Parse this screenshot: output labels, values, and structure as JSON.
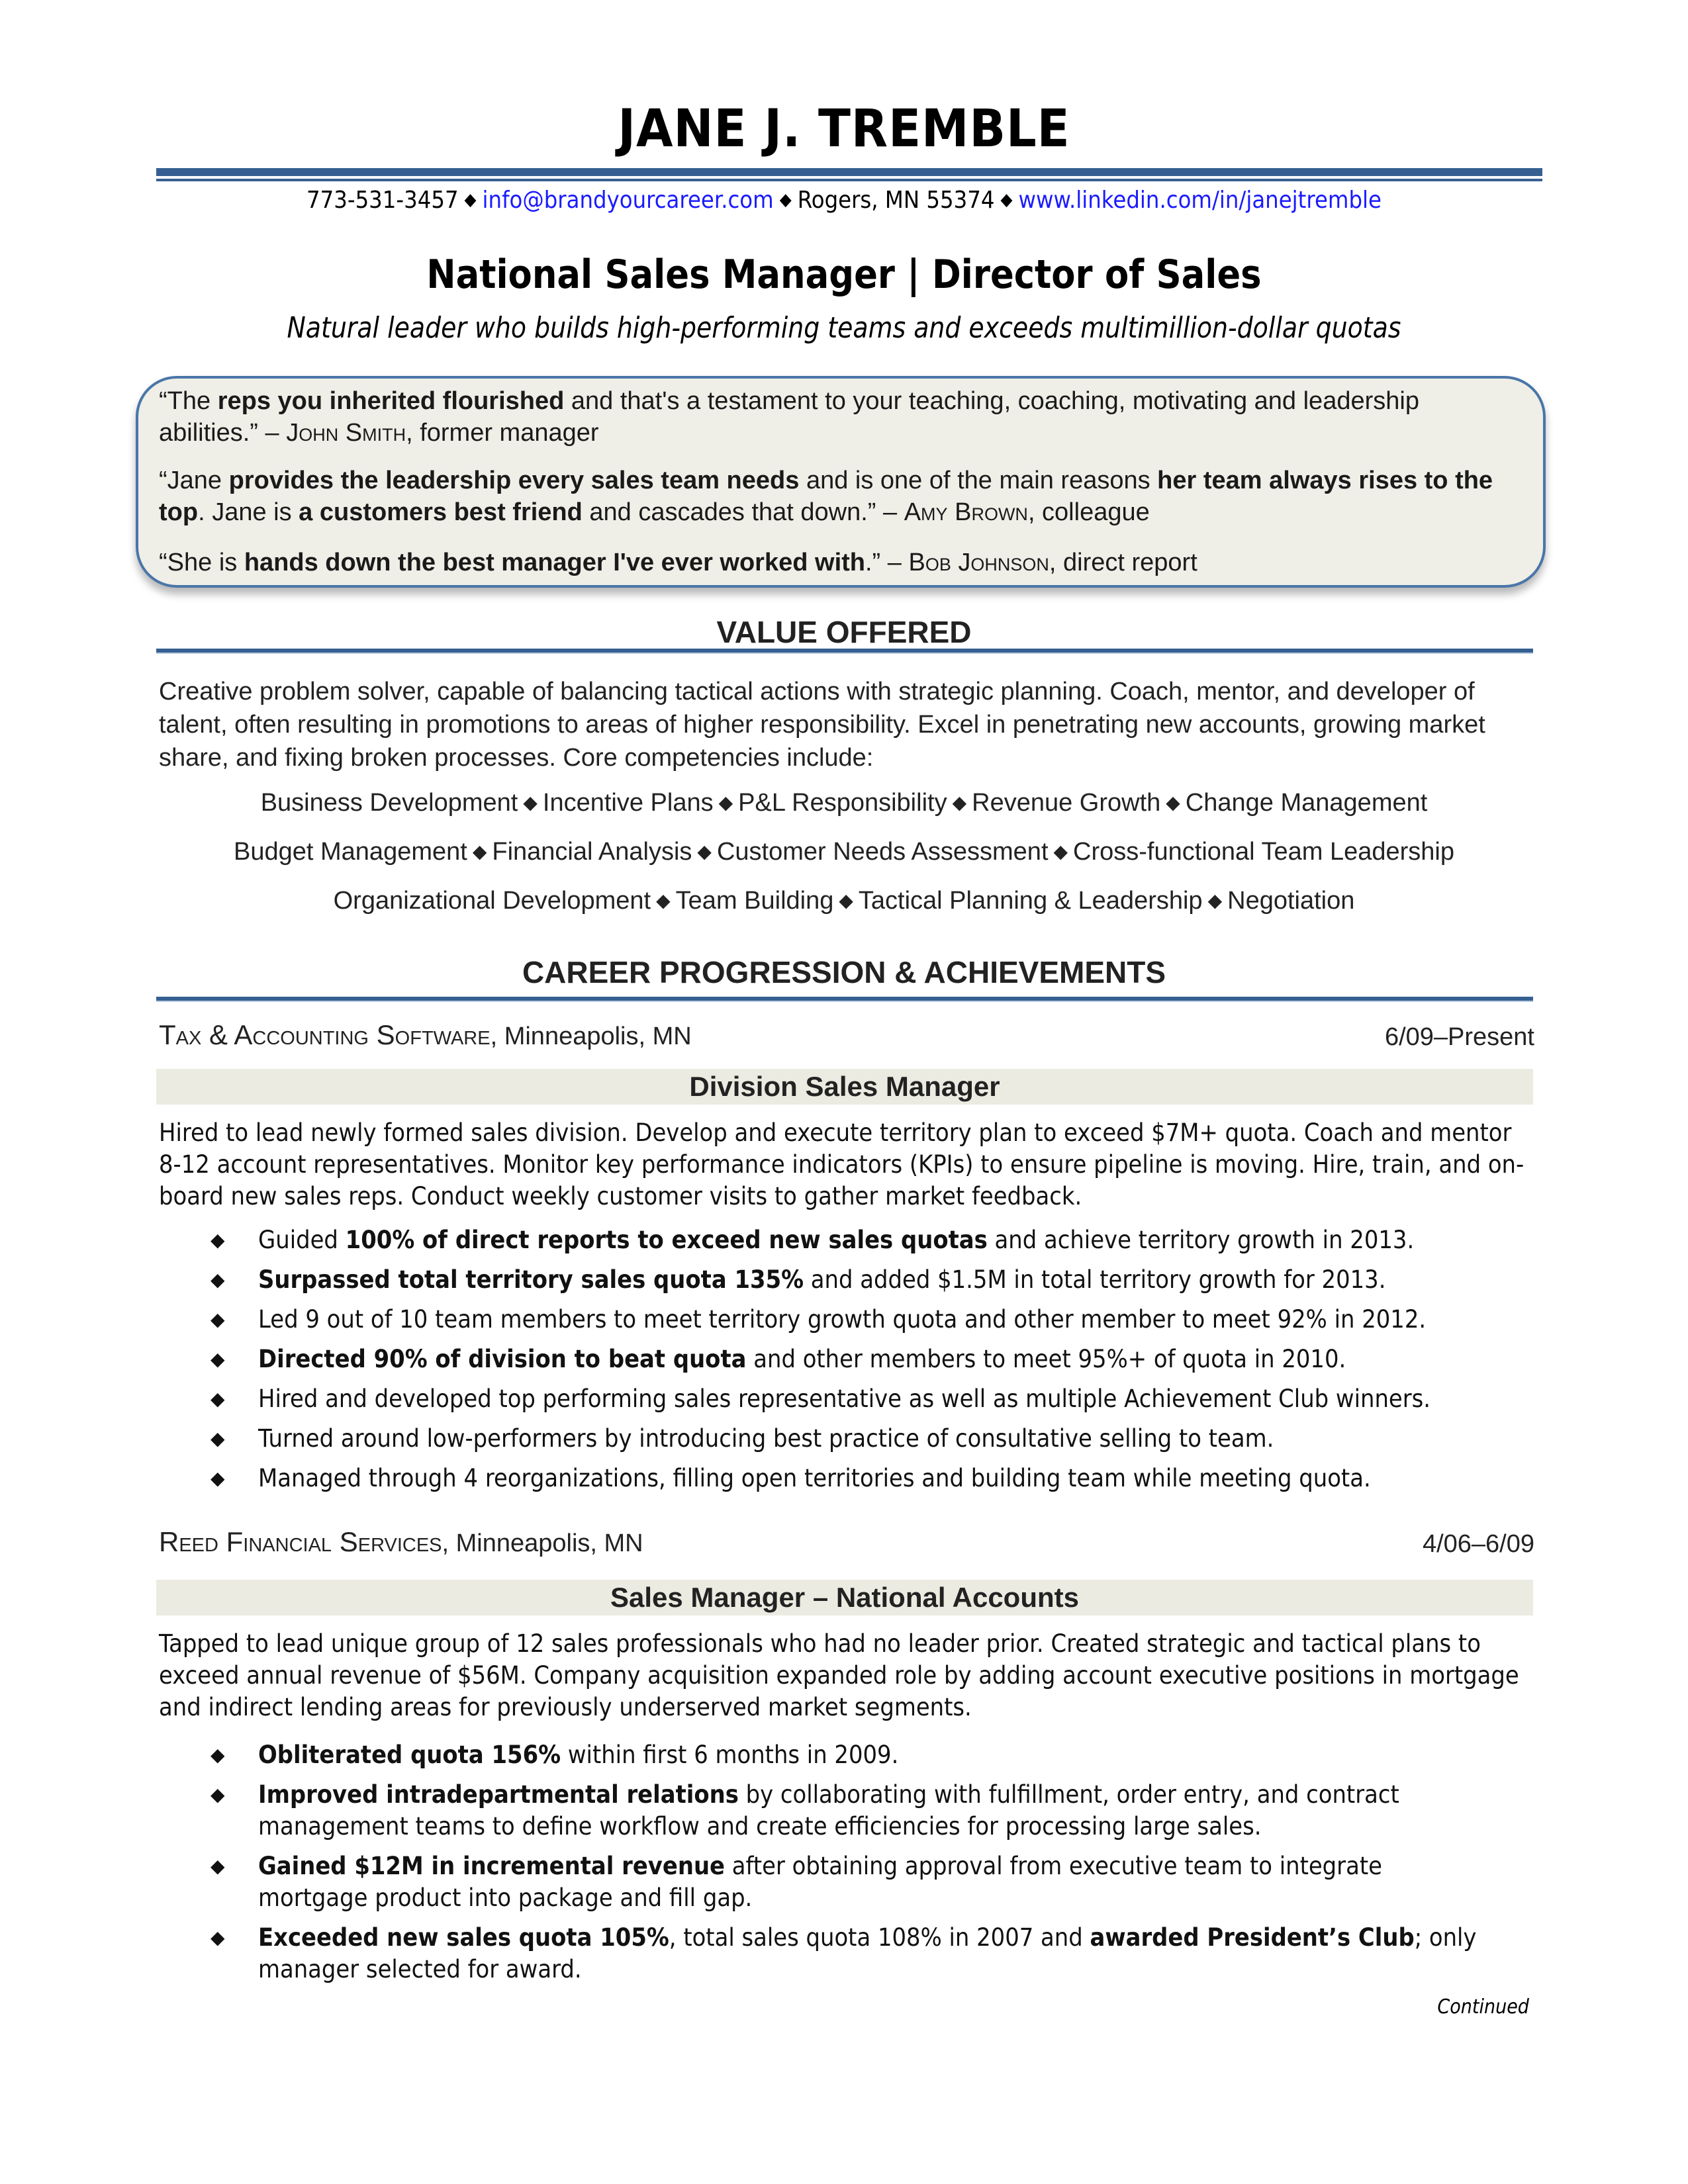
{
  "header": {
    "name": "JANE J. TREMBLE",
    "contact": {
      "phone": "773-531-3457",
      "email": "info@brandyourcareer.com",
      "location": "Rogers, MN 55374",
      "linkedin": "www.linkedin.com/in/janejtremble",
      "separator": "◆"
    },
    "headline": "National Sales Manager | Director of Sales",
    "tagline": "Natural leader who builds high-performing teams and exceeds multimillion-dollar quotas"
  },
  "testimonials": [
    {
      "parts": [
        {
          "t": "“The ",
          "b": false
        },
        {
          "t": "reps you inherited flourished",
          "b": true
        },
        {
          "t": " and that's a testament to your teaching, coaching, motivating and leadership abilities.” – ",
          "b": false
        }
      ],
      "author": "John Smith",
      "role": ", former manager"
    },
    {
      "parts": [
        {
          "t": "“Jane ",
          "b": false
        },
        {
          "t": "provides the leadership every sales team needs",
          "b": true
        },
        {
          "t": " and is one of the main reasons ",
          "b": false
        },
        {
          "t": "her team always rises to the top",
          "b": true
        },
        {
          "t": ". Jane is ",
          "b": false
        },
        {
          "t": "a customers best friend",
          "b": true
        },
        {
          "t": " and cascades that down.” – ",
          "b": false
        }
      ],
      "author": "Amy Brown",
      "role": ", colleague"
    },
    {
      "parts": [
        {
          "t": "“She is ",
          "b": false
        },
        {
          "t": "hands down the best manager I've ever worked with",
          "b": true
        },
        {
          "t": ".” – ",
          "b": false
        }
      ],
      "author": "Bob Johnson",
      "role": ", direct report"
    }
  ],
  "value_offered": {
    "title": "VALUE OFFERED",
    "summary": "Creative problem solver, capable of balancing tactical actions with strategic planning. Coach, mentor, and developer of talent, often resulting in promotions to areas of higher responsibility. Excel in penetrating new accounts, growing market share, and fixing broken processes. Core competencies include:",
    "competency_rows": [
      [
        "Business Development",
        "Incentive Plans",
        "P&L Responsibility",
        "Revenue Growth",
        "Change Management"
      ],
      [
        "Budget Management",
        "Financial Analysis",
        "Customer Needs Assessment",
        "Cross-functional Team Leadership"
      ],
      [
        "Organizational Development",
        "Team Building",
        "Tactical Planning & Leadership",
        "Negotiation"
      ]
    ]
  },
  "career": {
    "title": "CAREER PROGRESSION & ACHIEVEMENTS",
    "jobs": [
      {
        "company": "Tax & Accounting Software",
        "location": ", Minneapolis, MN",
        "dates": "6/09–Present",
        "role": "Division Sales Manager",
        "description": "Hired to lead newly formed sales division. Develop and execute territory plan to exceed $7M+ quota. Coach and mentor 8-12 account representatives. Monitor key performance indicators (KPIs) to ensure pipeline is moving. Hire, train, and on-board new sales reps. Conduct weekly customer visits to gather market feedback.",
        "bullets": [
          [
            {
              "t": "Guided ",
              "b": false
            },
            {
              "t": "100% of direct reports to exceed new sales quotas",
              "b": true
            },
            {
              "t": " and achieve territory growth in 2013.",
              "b": false
            }
          ],
          [
            {
              "t": "Surpassed total territory sales quota 135%",
              "b": true
            },
            {
              "t": " and added $1.5M in total territory growth for 2013.",
              "b": false
            }
          ],
          [
            {
              "t": "Led 9 out of 10 team members to meet territory growth quota and other member to meet 92% in 2012.",
              "b": false
            }
          ],
          [
            {
              "t": "Directed 90% of division to beat quota",
              "b": true
            },
            {
              "t": " and other members to meet 95%+ of quota in 2010.",
              "b": false
            }
          ],
          [
            {
              "t": "Hired and developed top performing sales representative as well as multiple Achievement Club winners.",
              "b": false
            }
          ],
          [
            {
              "t": "Turned around low-performers by introducing best practice of consultative selling to team.",
              "b": false
            }
          ],
          [
            {
              "t": "Managed through 4 reorganizations, filling open territories and building team while meeting quota.",
              "b": false
            }
          ]
        ]
      },
      {
        "company": "Reed Financial Services",
        "location": ", Minneapolis, MN",
        "dates": "4/06–6/09",
        "role": "Sales Manager – National Accounts",
        "description": "Tapped to lead unique group of 12 sales professionals who had no leader prior. Created strategic and tactical plans to exceed annual revenue of $56M. Company acquisition expanded role by adding account executive positions in mortgage and indirect lending areas for previously underserved market segments.",
        "bullets": [
          [
            {
              "t": "Obliterated quota 156%",
              "b": true
            },
            {
              "t": " within first 6 months in 2009.",
              "b": false
            }
          ],
          [
            {
              "t": "Improved intradepartmental relations",
              "b": true
            },
            {
              "t": " by collaborating with fulfillment, order entry, and contract management teams to define workflow and create efficiencies for processing large sales.",
              "b": false
            }
          ],
          [
            {
              "t": "Gained $12M in incremental revenue",
              "b": true
            },
            {
              "t": " after obtaining approval from executive team to integrate mortgage product into package and fill gap.",
              "b": false
            }
          ],
          [
            {
              "t": "Exceeded new sales quota 105%",
              "b": true
            },
            {
              "t": ", total sales quota 108% in 2007 and ",
              "b": false
            },
            {
              "t": "awarded President’s Club",
              "b": true
            },
            {
              "t": "; only manager selected for award.",
              "b": false
            }
          ]
        ]
      }
    ]
  },
  "footer": {
    "continued": "Continued"
  },
  "colors": {
    "accent": "#366092",
    "role_bar": "#ecebe1",
    "quote_box": "#efeee7",
    "link": "#1a1aff"
  }
}
